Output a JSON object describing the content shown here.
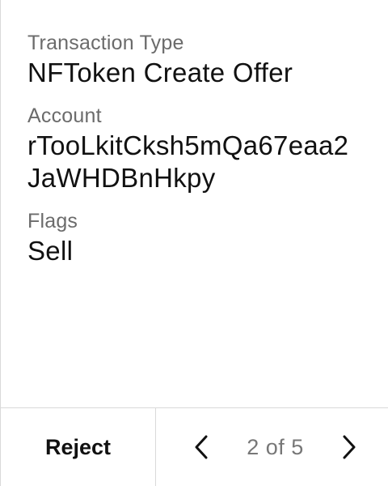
{
  "fields": [
    {
      "label": "Transaction Type",
      "value": "NFToken Create Offer"
    },
    {
      "label": "Account",
      "value": "rTooLkitCksh5mQa67eaa2JaWHDBnHkpy"
    },
    {
      "label": "Flags",
      "value": "Sell"
    }
  ],
  "footer": {
    "reject_label": "Reject",
    "pager": {
      "label": "2 of 5",
      "prev_icon": "chevron-left-icon",
      "next_icon": "chevron-right-icon"
    }
  }
}
